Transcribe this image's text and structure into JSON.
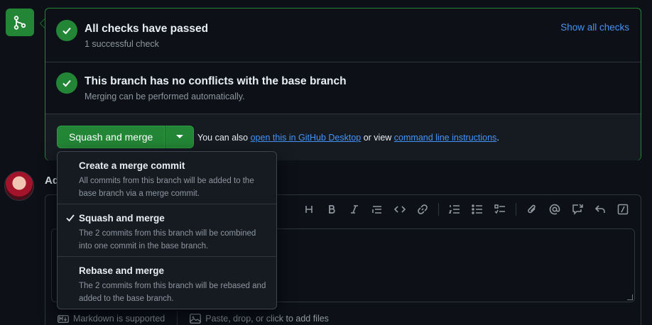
{
  "checks": {
    "title": "All checks have passed",
    "subtitle": "1 successful check",
    "show_all_label": "Show all checks"
  },
  "conflicts": {
    "title": "This branch has no conflicts with the base branch",
    "subtitle": "Merging can be performed automatically."
  },
  "merge": {
    "button_label": "Squash and merge",
    "also_prefix": "You can also ",
    "desktop_link": "open this in GitHub Desktop",
    "or_view": " or view ",
    "cli_link": "command line instructions",
    "suffix": "."
  },
  "dropdown": {
    "items": [
      {
        "title": "Create a merge commit",
        "description": "All commits from this branch will be added to the base branch via a merge commit.",
        "selected": false
      },
      {
        "title": "Squash and merge",
        "description": "The 2 commits from this branch will be combined into one commit in the base branch.",
        "selected": true
      },
      {
        "title": "Rebase and merge",
        "description": "The 2 commits from this branch will be rebased and added to the base branch.",
        "selected": false
      }
    ]
  },
  "comment": {
    "heading_partial": "Ad",
    "markdown_label": "Markdown is supported",
    "files_label": "Paste, drop, or click to add files",
    "toolbar_icons": [
      "heading-icon",
      "bold-icon",
      "italic-icon",
      "quote-icon",
      "code-icon",
      "link-icon",
      "ordered-list-icon",
      "unordered-list-icon",
      "task-list-icon",
      "attach-icon",
      "mention-icon",
      "cross-reference-icon",
      "reply-icon",
      "slash-command-icon"
    ]
  },
  "colors": {
    "accent_green": "#238636",
    "link_blue": "#4493f8",
    "background": "#0d1117"
  }
}
